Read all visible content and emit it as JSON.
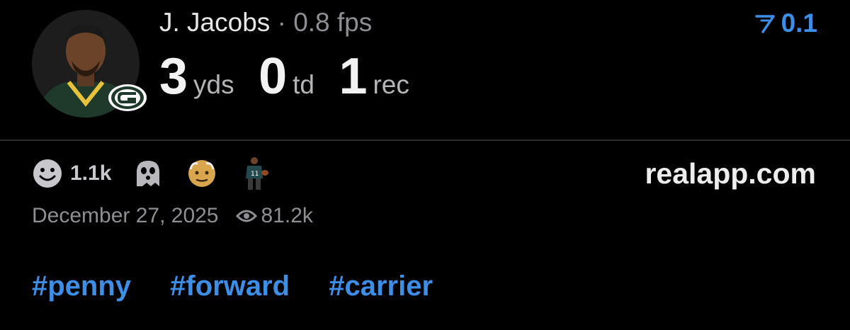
{
  "player": {
    "name": "J. Jacobs",
    "separator": "·",
    "fps": "0.8 fps"
  },
  "stats": [
    {
      "value": "3",
      "unit": "yds"
    },
    {
      "value": "0",
      "unit": "td"
    },
    {
      "value": "1",
      "unit": "rec"
    }
  ],
  "rating": {
    "value": "0.1",
    "icon": "arrow-icon",
    "color": "#3d8ee6"
  },
  "reactions": {
    "smile_count": "1.1k"
  },
  "site": "realapp.com",
  "meta": {
    "date": "December 27, 2025",
    "views": "81.2k"
  },
  "tags": [
    "#penny",
    "#forward",
    "#carrier"
  ],
  "colors": {
    "background": "#000000",
    "accent": "#3d8ee6",
    "muted": "#8e8e93"
  }
}
